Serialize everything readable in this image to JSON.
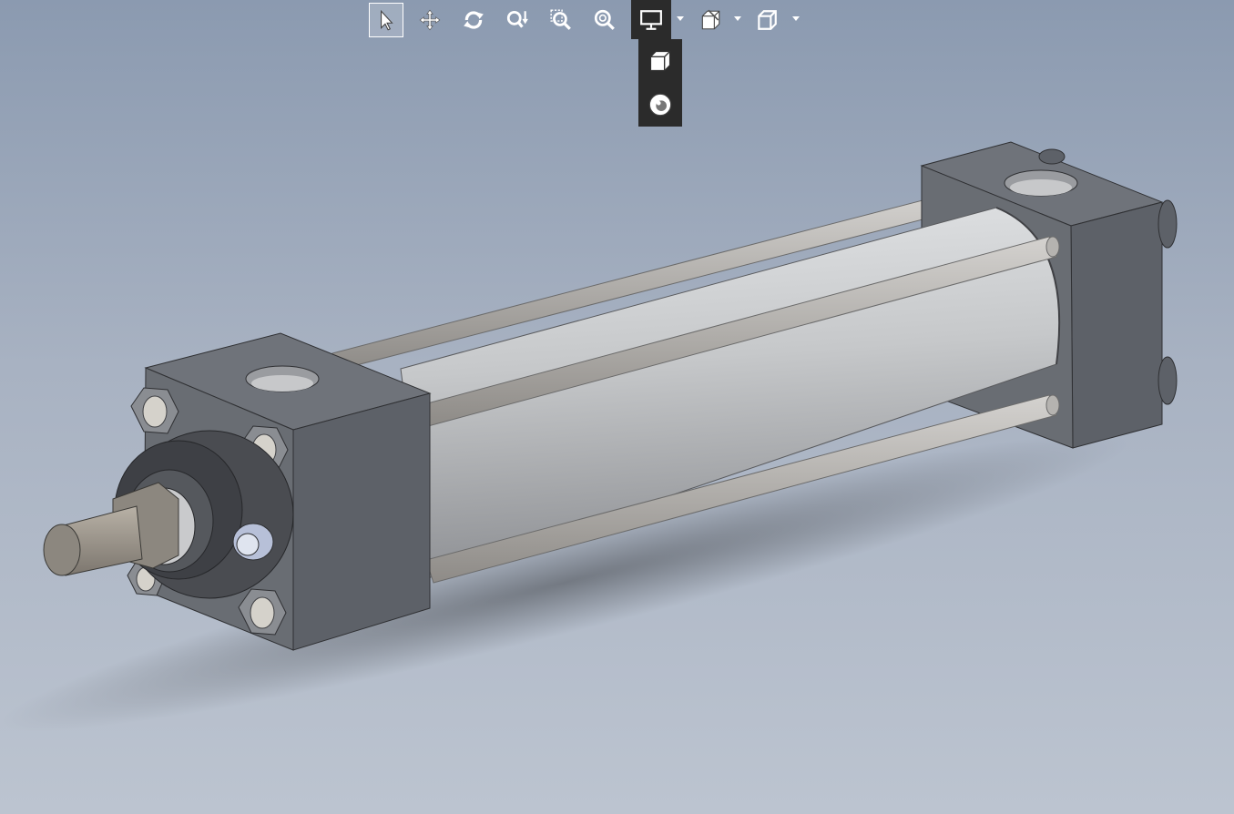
{
  "viewport": {
    "background_top": "#8b9ab0",
    "background_bottom": "#bcc4d0",
    "model": {
      "name": "pneumatic-cylinder",
      "body_color": "#c3c5c7",
      "block_color": "#5d6168",
      "rod_color": "#9d968c"
    }
  },
  "toolbar": {
    "items": [
      {
        "name": "select-icon",
        "selected": true
      },
      {
        "name": "pan-icon"
      },
      {
        "name": "rotate-icon"
      },
      {
        "name": "zoom-in-out-icon"
      },
      {
        "name": "zoom-to-area-icon"
      },
      {
        "name": "zoom-to-fit-icon"
      },
      {
        "name": "display-style-icon",
        "has_dropdown": true,
        "expanded": true
      },
      {
        "name": "section-view-icon",
        "has_dropdown": true
      },
      {
        "name": "view-orientation-icon",
        "has_dropdown": true
      }
    ],
    "flyout": [
      {
        "name": "shaded-cube-icon"
      },
      {
        "name": "appearance-sphere-icon"
      }
    ]
  }
}
